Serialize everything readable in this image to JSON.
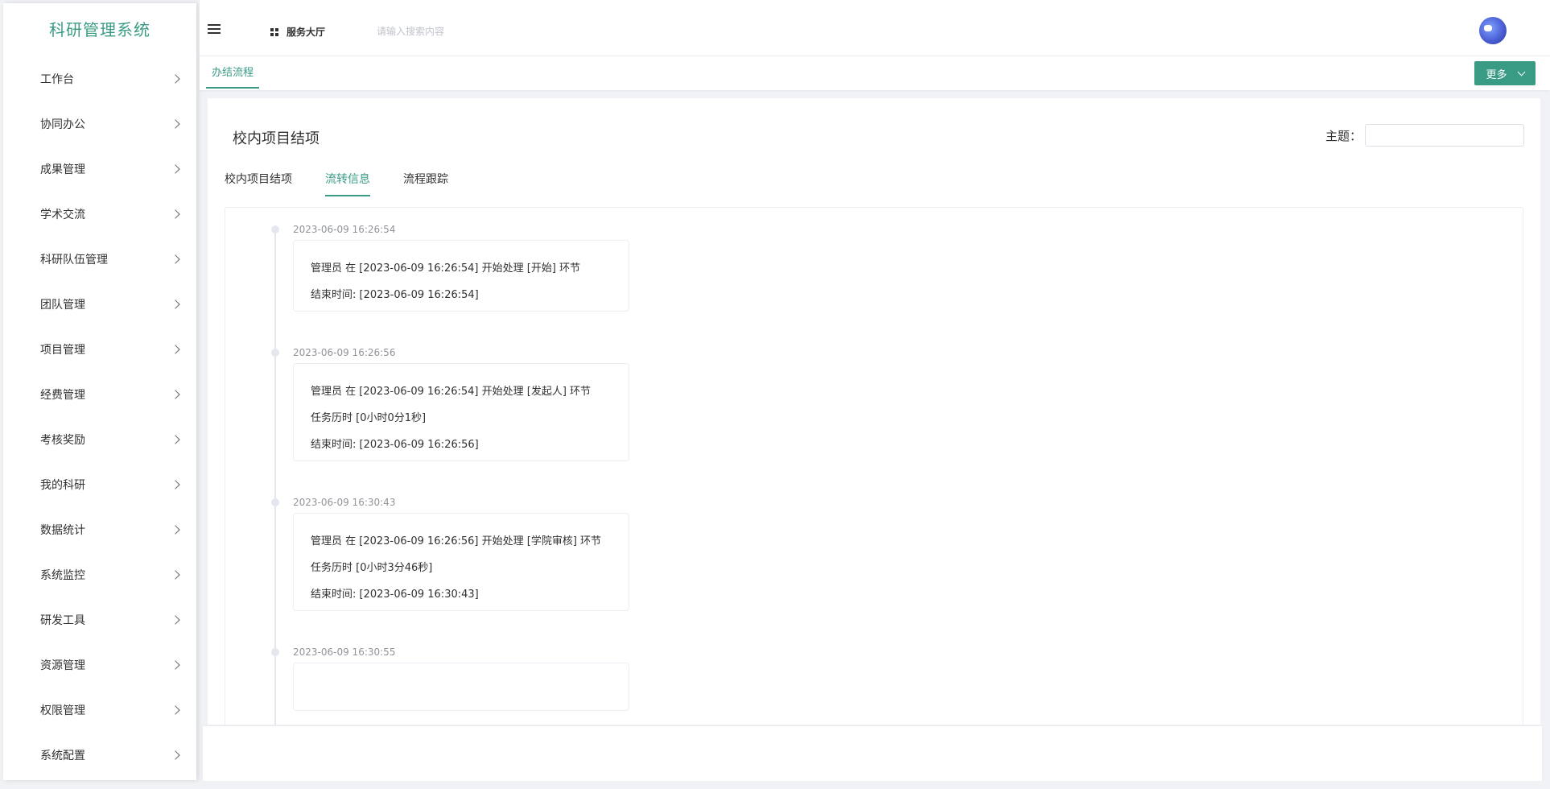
{
  "sidebar": {
    "title": "科研管理系统",
    "items": [
      {
        "label": "工作台"
      },
      {
        "label": "协同办公"
      },
      {
        "label": "成果管理"
      },
      {
        "label": "学术交流"
      },
      {
        "label": "科研队伍管理"
      },
      {
        "label": "团队管理"
      },
      {
        "label": "项目管理"
      },
      {
        "label": "经费管理"
      },
      {
        "label": "考核奖励"
      },
      {
        "label": "我的科研"
      },
      {
        "label": "数据统计"
      },
      {
        "label": "系统监控"
      },
      {
        "label": "研发工具"
      },
      {
        "label": "资源管理"
      },
      {
        "label": "权限管理"
      },
      {
        "label": "系统配置"
      }
    ]
  },
  "header": {
    "service_hall": "服务大厅",
    "search_placeholder": "请输入搜索内容"
  },
  "tagbar": {
    "active_tag": "办结流程",
    "more_label": "更多"
  },
  "main": {
    "page_title": "校内项目结项",
    "subject_label": "主题：",
    "subject_value": "",
    "tabs": [
      {
        "label": "校内项目结项",
        "active": false
      },
      {
        "label": "流转信息",
        "active": true
      },
      {
        "label": "流程跟踪",
        "active": false
      }
    ],
    "timeline": [
      {
        "time": "2023-06-09 16:26:54",
        "lines": [
          "管理员 在 [2023-06-09 16:26:54] 开始处理 [开始] 环节",
          "结束时间: [2023-06-09 16:26:54]"
        ]
      },
      {
        "time": "2023-06-09 16:26:56",
        "lines": [
          "管理员 在 [2023-06-09 16:26:54] 开始处理 [发起人] 环节",
          "任务历时 [0小时0分1秒]",
          "结束时间: [2023-06-09 16:26:56]"
        ]
      },
      {
        "time": "2023-06-09 16:30:43",
        "lines": [
          "管理员 在 [2023-06-09 16:26:56] 开始处理 [学院审核] 环节",
          "任务历时 [0小时3分46秒]",
          "结束时间: [2023-06-09 16:30:43]"
        ]
      },
      {
        "time": "2023-06-09 16:30:55",
        "lines": []
      }
    ]
  },
  "colors": {
    "accent": "#3a9b85"
  }
}
